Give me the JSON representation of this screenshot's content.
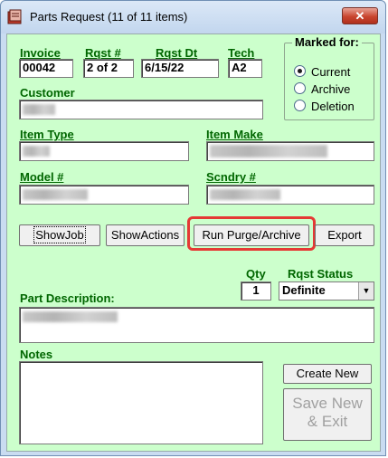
{
  "window": {
    "title": "Parts Request (11 of 11 items)",
    "close_glyph": "✕"
  },
  "fields": {
    "invoice": {
      "label": "Invoice",
      "value": "00042"
    },
    "rqst_num": {
      "label": "Rqst #",
      "value": "2 of 2"
    },
    "rqst_dt": {
      "label": "Rqst Dt",
      "value": "6/15/22"
    },
    "tech": {
      "label": "Tech",
      "value": "A2"
    },
    "customer": {
      "label": "Customer",
      "value": ""
    },
    "item_type": {
      "label": "Item Type",
      "value": ""
    },
    "item_make": {
      "label": "Item Make",
      "value": ""
    },
    "model": {
      "label": "Model #",
      "value": ""
    },
    "scndry": {
      "label": "Scndry #",
      "value": ""
    },
    "qty": {
      "label": "Qty",
      "value": "1"
    },
    "rqst_status": {
      "label": "Rqst Status",
      "value": "Definite"
    },
    "part_description": {
      "label": "Part Description:",
      "value": ""
    },
    "notes": {
      "label": "Notes",
      "value": ""
    }
  },
  "marked_for": {
    "title": "Marked for:",
    "options": [
      "Current",
      "Archive",
      "Deletion"
    ],
    "selected": "Current"
  },
  "buttons": {
    "show_job": "ShowJob",
    "show_actions": "ShowActions",
    "run_purge": "Run Purge/Archive",
    "export": "Export",
    "create_new": "Create New",
    "save_new_line1": "Save New",
    "save_new_line2": "& Exit"
  },
  "colors": {
    "label_green": "#006600",
    "client_bg": "#ccffcc",
    "highlight": "#e53935"
  },
  "icons": {
    "title_icon": "parts-request-app-icon",
    "close_icon": "close-icon"
  }
}
